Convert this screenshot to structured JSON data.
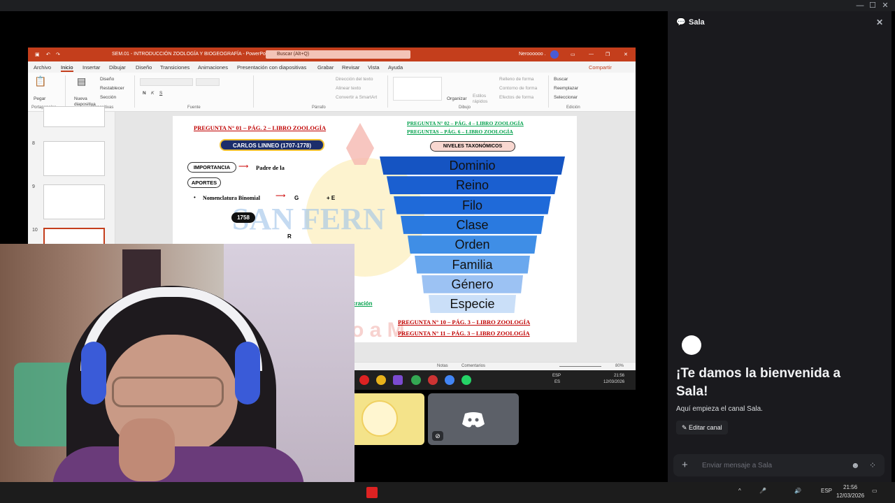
{
  "ppt": {
    "title": "SEM.01 - INTRODUCCIÓN ZOOLOGÍA Y BIOGEOGRAFÍA - PowerPoint",
    "search_placeholder": "Buscar (Alt+Q)",
    "user": "Neroooooo .",
    "share": "Compartir",
    "tabs": [
      "Archivo",
      "Inicio",
      "Insertar",
      "Dibujar",
      "Diseño",
      "Transiciones",
      "Animaciones",
      "Presentación con diapositivas",
      "Grabar",
      "Revisar",
      "Vista",
      "Ayuda"
    ],
    "ribbon": {
      "paste": "Pegar",
      "new_slide": "Nueva diapositiva",
      "design": "Diseño",
      "reset": "Restablecer",
      "section": "Sección",
      "text_direction": "Dirección del texto",
      "align_text": "Alinear texto",
      "smartart": "Convertir a SmartArt",
      "arrange": "Organizar",
      "quick_styles": "Estilos rápidos",
      "shape_fill": "Relleno de forma",
      "shape_outline": "Contorno de forma",
      "shape_effects": "Efectos de forma",
      "find": "Buscar",
      "replace": "Reemplazar",
      "select": "Seleccionar",
      "groups": [
        "Portapapeles",
        "Diapositivas",
        "Fuente",
        "Párrafo",
        "Dibujo",
        "Edición"
      ]
    },
    "thumb_numbers": [
      "8",
      "9",
      "10"
    ],
    "status": {
      "notes": "Notas",
      "comments": "Comentarios",
      "zoom": "80%"
    }
  },
  "slide": {
    "q1": "PREGUNTA N° 01 – PÁG. 2 – LIBRO ZOOLOGÍA",
    "q2": "PREGUNTA N° 02 – PÁG. 4 – LIBRO ZOOLOGÍA",
    "q3": "PREGUNTAS – PÁG. 6 – LIBRO ZOOLOGÍA",
    "linneo": "CARLOS LINNEO (1707-1778)",
    "importancia": "IMPORTANCIA",
    "padre": "Padre de la",
    "aportes": "APORTES",
    "nomen": "Nomenclatura Binomial",
    "g": "G",
    "e": "+ E",
    "year": "1758",
    "r": "R",
    "niveles": "NIVELES TAXONÓMICOS",
    "levels": [
      "Dominio",
      "Reino",
      "Filo",
      "Clase",
      "Orden",
      "Familia",
      "Género",
      "Especie"
    ],
    "level_colors": [
      "#1554c2",
      "#1a5fd0",
      "#1f6ad9",
      "#2a7ae0",
      "#3f8ee6",
      "#6aa8ee",
      "#9cc2f3",
      "#cadff8"
    ],
    "watermark": "SAN FERN",
    "watermark2": "o a M",
    "cracion": "cración",
    "q10": "PREGUNTA N° 10 – PÁG. 3 – LIBRO ZOOLOGÍA",
    "q11": "PREGUNTA N° 11 – PÁG. 3 – LIBRO ZOOLOGÍA"
  },
  "mini_taskbar": {
    "lang": "ESP",
    "lang2": "ES",
    "time": "21:56",
    "date": "12/03/2026"
  },
  "chat": {
    "title": "Sala",
    "welcome": "¡Te damos la bienvenida a Sala!",
    "subtitle": "Aquí empieza el canal Sala.",
    "edit": "Editar canal",
    "input_placeholder": "Enviar mensaje a Sala"
  },
  "taskbar": {
    "lang": "ESP",
    "time": "21:56",
    "date": "12/03/2026"
  }
}
